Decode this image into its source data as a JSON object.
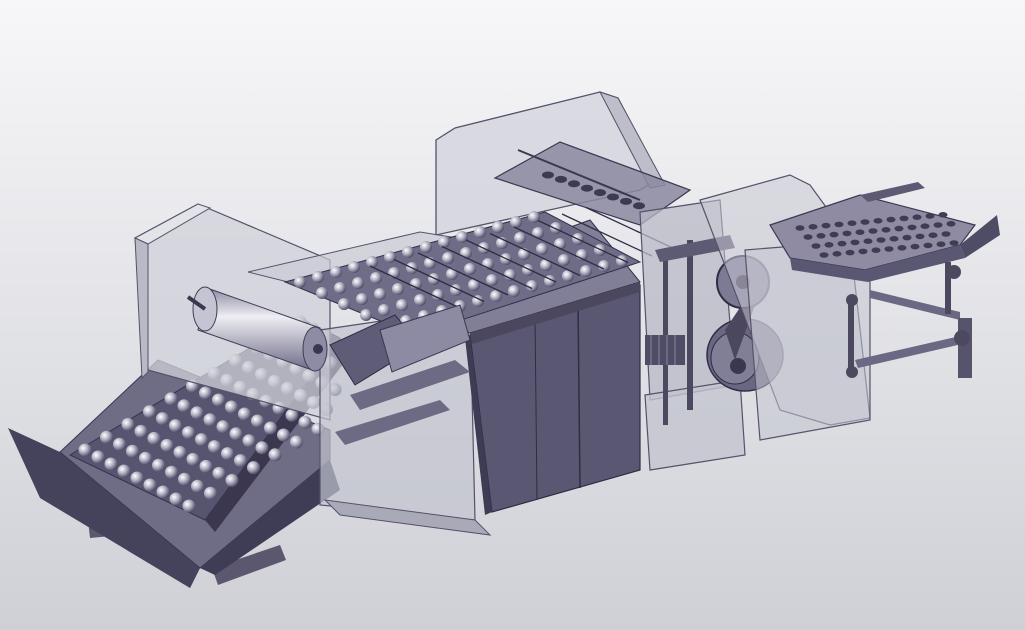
{
  "viewport": {
    "kind": "3d-cad-assembly-view",
    "subject": "egg-processing-conveyor-machine",
    "colors": {
      "background_top": "#f7f7f9",
      "background_bottom": "#cfd0d6",
      "steel_dark": "#4f4c66",
      "steel_mid": "#6c6984",
      "steel_light": "#9a98ad",
      "glass": "#c8c9d3",
      "glass_edge": "#55526a",
      "roller_highlight": "#e9e9ef"
    },
    "icon_names": [
      "cad-model-icon"
    ]
  }
}
